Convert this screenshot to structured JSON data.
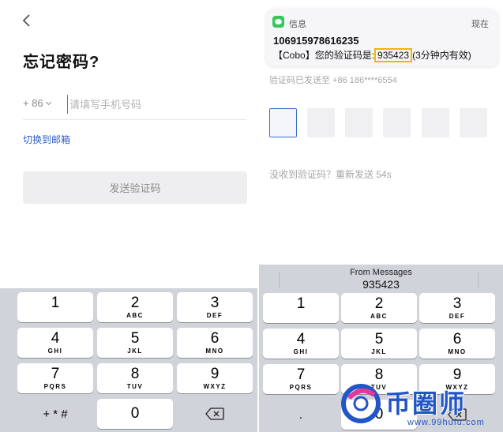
{
  "left": {
    "title": "忘记密码?",
    "country_code": "+ 86",
    "phone_placeholder": "请填写手机号码",
    "switch_link": "切换到邮箱",
    "send_button": "发送验证码"
  },
  "right": {
    "notification": {
      "app": "信息",
      "time": "现在",
      "sender": "106915978616235",
      "body_prefix": "【Cobo】您的验证码是:",
      "code": "935423",
      "body_suffix": "(3分钟内有效)",
      "highlight_color": "#f2b705"
    },
    "sent_hint": "验证码已发送至 +86 186****6554",
    "code_boxes": [
      "",
      "",
      "",
      "",
      "",
      ""
    ],
    "resend": "没收到验证码？重新发送 54s",
    "suggestion": {
      "source": "From Messages",
      "code": "935423"
    }
  },
  "keypad": {
    "keys": [
      {
        "num": "1",
        "letters": ""
      },
      {
        "num": "2",
        "letters": "ABC"
      },
      {
        "num": "3",
        "letters": "DEF"
      },
      {
        "num": "4",
        "letters": "GHI"
      },
      {
        "num": "5",
        "letters": "JKL"
      },
      {
        "num": "6",
        "letters": "MNO"
      },
      {
        "num": "7",
        "letters": "PQRS"
      },
      {
        "num": "8",
        "letters": "TUV"
      },
      {
        "num": "9",
        "letters": "WXYZ"
      }
    ],
    "symbols_key_left": "+ * #",
    "symbols_key_right": ".",
    "zero_key": "0",
    "delete_icon": "backspace-icon"
  },
  "watermark": {
    "text": "币圈师",
    "url": "www.99hufu.com"
  },
  "colors": {
    "link": "#2f5ec2",
    "keyboard_bg": "#d0d3d9",
    "code_box_active_border": "#3c6fc7"
  }
}
